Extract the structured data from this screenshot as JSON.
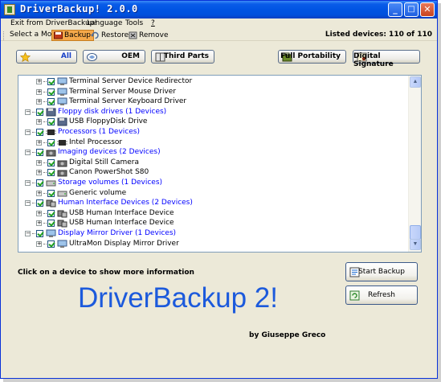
{
  "window": {
    "title": "DriverBackup! 2.0.0",
    "controls": {
      "minimize": "_",
      "maximize": "□",
      "close": "✕"
    }
  },
  "menu": {
    "items": [
      "Exit from DriverBackup!",
      "Language",
      "Tools",
      "?"
    ]
  },
  "toolbar": {
    "mode_label": "Select a Mode",
    "backup": "Backup",
    "restore": "Restore",
    "remove": "Remove",
    "listed_devices": "Listed devices: 110 of 110"
  },
  "filters": {
    "all": "All",
    "oem": "OEM",
    "third_parts": "Third Parts",
    "full_portability": "Full Portability",
    "digital_signature": "Digital Signature"
  },
  "tree": {
    "rows": [
      {
        "level": 1,
        "text": "Terminal Server Device Redirector",
        "icon": "monitor-icon"
      },
      {
        "level": 1,
        "text": "Terminal Server Mouse Driver",
        "icon": "monitor-icon"
      },
      {
        "level": 1,
        "text": "Terminal Server Keyboard Driver",
        "icon": "monitor-icon"
      },
      {
        "level": 0,
        "text": "Floppy disk drives   (1 Devices)",
        "icon": "floppy-icon"
      },
      {
        "level": 1,
        "text": "USB FloppyDisk Drive",
        "icon": "floppy-icon"
      },
      {
        "level": 0,
        "text": "Processors   (1 Devices)",
        "icon": "processor-icon"
      },
      {
        "level": 1,
        "text": "Intel Processor",
        "icon": "processor-icon"
      },
      {
        "level": 0,
        "text": "Imaging devices   (2 Devices)",
        "icon": "camera-icon"
      },
      {
        "level": 1,
        "text": "Digital Still Camera",
        "icon": "camera-icon"
      },
      {
        "level": 1,
        "text": "Canon PowerShot S80",
        "icon": "camera-icon"
      },
      {
        "level": 0,
        "text": "Storage volumes   (1 Devices)",
        "icon": "drive-icon"
      },
      {
        "level": 1,
        "text": "Generic volume",
        "icon": "drive-icon"
      },
      {
        "level": 0,
        "text": "Human Interface Devices   (2 Devices)",
        "icon": "hid-icon"
      },
      {
        "level": 1,
        "text": "USB Human Interface Device",
        "icon": "hid-icon"
      },
      {
        "level": 1,
        "text": "USB Human Interface Device",
        "icon": "hid-icon"
      },
      {
        "level": 0,
        "text": "Display Mirror Driver   (1 Devices)",
        "icon": "monitor-icon"
      },
      {
        "level": 1,
        "text": "UltraMon Display Mirror Driver",
        "icon": "monitor-icon"
      }
    ]
  },
  "main": {
    "info_hint": "Click on a device to show more information",
    "app_name": "DriverBackup 2!",
    "author": "by Giuseppe Greco",
    "start_backup": "Start Backup",
    "refresh": "Refresh"
  }
}
